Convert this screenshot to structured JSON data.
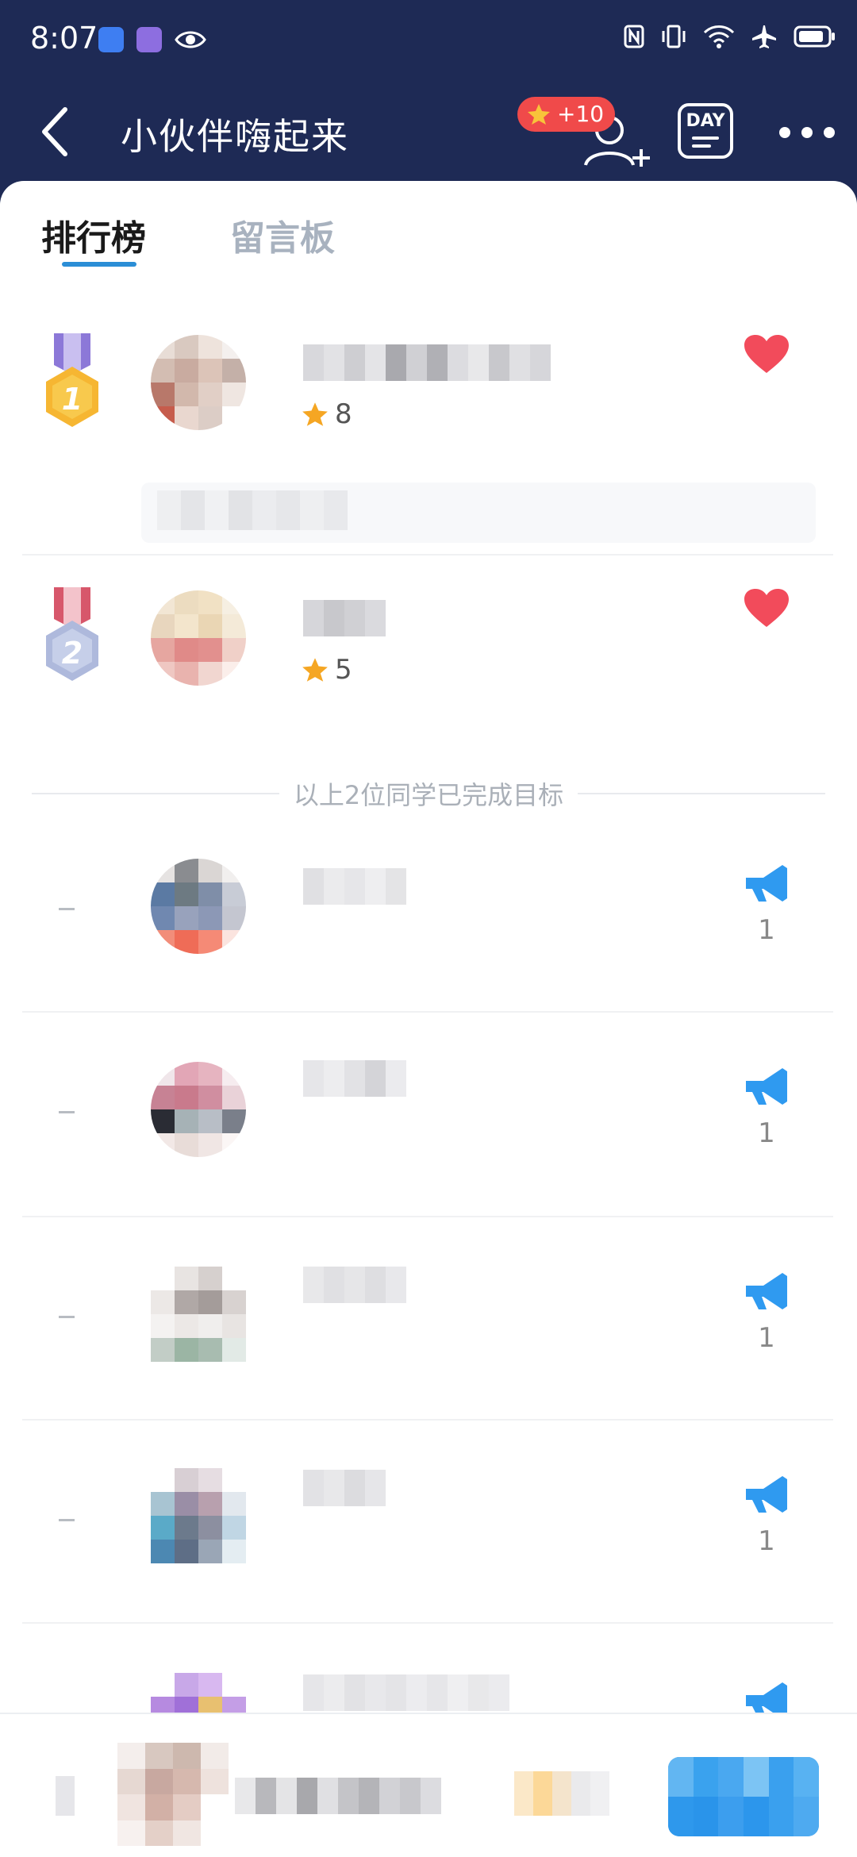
{
  "status_bar": {
    "time": "8:07"
  },
  "header": {
    "title": "小伙伴嗨起来",
    "badge_text": "+10",
    "day_label": "DAY"
  },
  "tabs": [
    {
      "label": "排行榜",
      "active": true
    },
    {
      "label": "留言板",
      "active": false
    }
  ],
  "leaderboard": {
    "top": [
      {
        "rank": 1,
        "stars": "8",
        "liked": true
      },
      {
        "rank": 2,
        "stars": "5",
        "liked": true
      }
    ],
    "divider_text": "以上2位同学已完成目标",
    "others": [
      {
        "rank_label": "–",
        "count": "1"
      },
      {
        "rank_label": "–",
        "count": "1"
      },
      {
        "rank_label": "–",
        "count": "1"
      },
      {
        "rank_label": "–",
        "count": "1"
      },
      {
        "rank_label": "–",
        "count": ""
      }
    ]
  },
  "colors": {
    "header_bg": "#1e2a55",
    "accent_blue": "#2b8ed6",
    "heart_red": "#f24b5b",
    "badge_red": "#f04a4a",
    "star_gold": "#f5a623",
    "megaphone_blue": "#2f9af0"
  }
}
